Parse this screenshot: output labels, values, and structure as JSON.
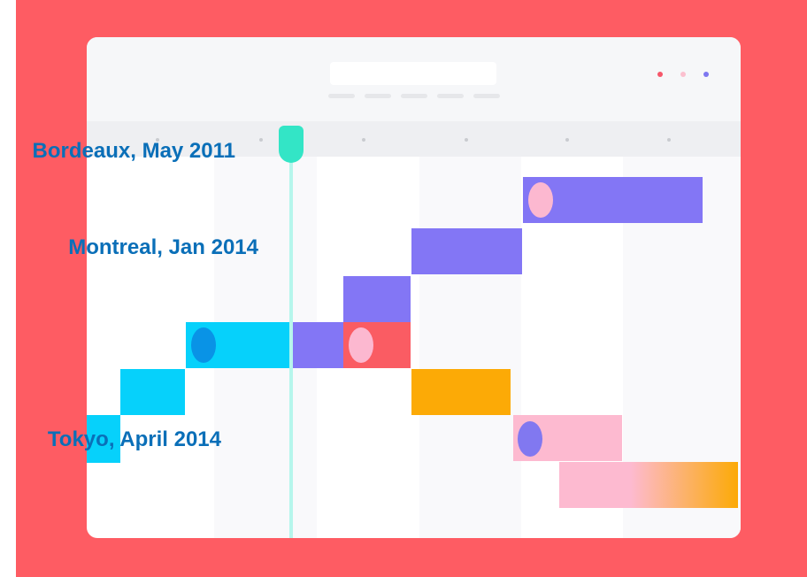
{
  "colors": {
    "background": "#fe5c63",
    "card": "#ffffff",
    "purple": "#8376f5",
    "cyan": "#06d1fb",
    "coral": "#fa5c63",
    "orange": "#fcaa06",
    "pink": "#fdbad0",
    "today_marker": "#33e5c6"
  },
  "window_dots": [
    "#f6576a",
    "#fbc0cf",
    "#7d77f0"
  ],
  "labels": {
    "label_1": "Bordeaux, May 2011",
    "label_2": "Montreal, Jan 2014",
    "label_3": "Tokyo, April 2014"
  },
  "tasks": [
    {
      "name": "row-1-bar",
      "color": "purple",
      "knob": "pink"
    },
    {
      "name": "row-2-bar",
      "color": "purple"
    },
    {
      "name": "row-3-bar",
      "color": "purple"
    },
    {
      "name": "row-4-bar-cyan",
      "color": "cyan",
      "knob": "blue"
    },
    {
      "name": "row-4-bar-purple",
      "color": "purple"
    },
    {
      "name": "row-4-bar-coral",
      "color": "coral",
      "knob": "pink"
    },
    {
      "name": "row-5-bar-cyan",
      "color": "cyan"
    },
    {
      "name": "row-5-bar-orange",
      "color": "orange"
    },
    {
      "name": "row-6-bar-cyan",
      "color": "cyan"
    },
    {
      "name": "row-6-bar-pink",
      "color": "pink",
      "knob": "purple"
    },
    {
      "name": "row-7-bar-gradient",
      "color": "pink-to-orange"
    }
  ]
}
